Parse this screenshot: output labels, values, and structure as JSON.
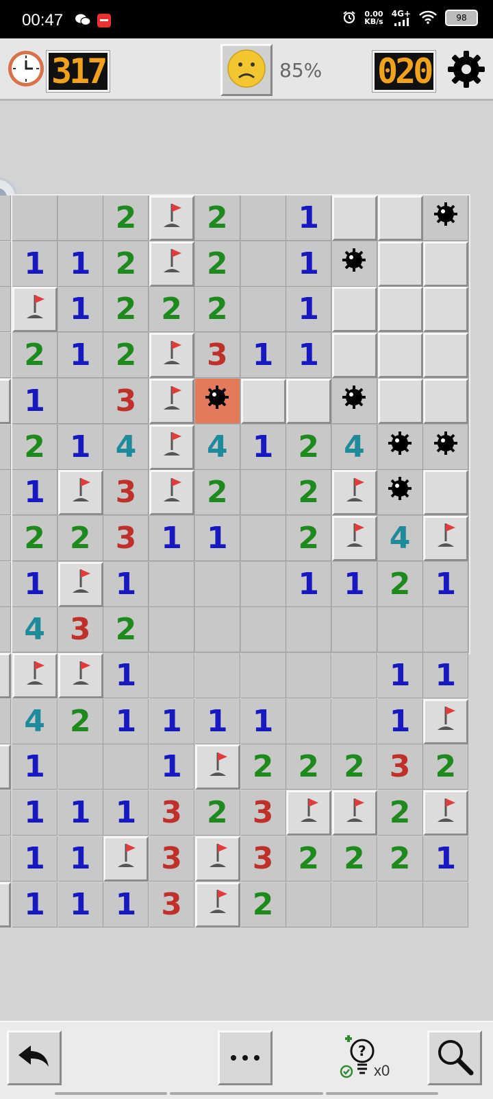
{
  "status_bar": {
    "time": "00:47",
    "net_speed_top": "0.00",
    "net_speed_unit": "KB/s",
    "network": "4G+",
    "battery": "98"
  },
  "header": {
    "timer": "317",
    "progress": "85%",
    "mines_left": "020"
  },
  "bottom": {
    "hint_count": "x0"
  },
  "board": {
    "rows": [
      [
        "",
        "",
        "2",
        "F",
        "2",
        "",
        "1",
        "C",
        "C",
        "M"
      ],
      [
        "1",
        "1",
        "2",
        "F",
        "2",
        "",
        "1",
        "M",
        "C",
        "C"
      ],
      [
        "F",
        "1",
        "2",
        "2",
        "2",
        "",
        "1",
        "C",
        "C",
        "C"
      ],
      [
        "2",
        "1",
        "2",
        "F",
        "3",
        "1",
        "1",
        "C",
        "C",
        "C"
      ],
      [
        "1",
        "",
        "3",
        "F",
        "X",
        "C",
        "C",
        "M",
        "C",
        "C"
      ],
      [
        "2",
        "1",
        "4",
        "F",
        "4",
        "1",
        "2",
        "4",
        "M",
        "M"
      ],
      [
        "1",
        "F",
        "3",
        "F",
        "2",
        "",
        "2",
        "F",
        "M",
        "C"
      ],
      [
        "2",
        "2",
        "3",
        "1",
        "1",
        "",
        "2",
        "F",
        "4",
        "F"
      ],
      [
        "1",
        "F",
        "1",
        "",
        "",
        "",
        "1",
        "1",
        "2",
        "1"
      ],
      [
        "4",
        "3",
        "2",
        "",
        "",
        "",
        "",
        "",
        "",
        ""
      ],
      [
        "F",
        "F",
        "1",
        "",
        "",
        "",
        "",
        "",
        "1",
        "1"
      ],
      [
        "4",
        "2",
        "1",
        "1",
        "1",
        "1",
        "",
        "",
        "1",
        "F"
      ],
      [
        "1",
        "",
        "",
        "1",
        "F",
        "2",
        "2",
        "2",
        "3",
        "2"
      ],
      [
        "1",
        "1",
        "1",
        "3",
        "2",
        "3",
        "F",
        "F",
        "2",
        "F"
      ],
      [
        "1",
        "1",
        "F",
        "3",
        "F",
        "3",
        "2",
        "2",
        "2",
        "1"
      ],
      [
        "1",
        "1",
        "1",
        "3",
        "F",
        "2",
        "",
        "",
        "",
        ""
      ]
    ],
    "left_edge": [
      "open",
      "open",
      "open",
      "open",
      "closed",
      "open",
      "open",
      "open",
      "open",
      "open",
      "closed",
      "open",
      "closed",
      "open",
      "open",
      "closed"
    ]
  },
  "colors": {
    "n1": "#1818c0",
    "n2": "#1e8a1e",
    "n3": "#c0302a",
    "n4": "#1f8a9a",
    "counter": "#f1a21d",
    "exploded": "#e37a5c"
  },
  "icons": [
    "clock-icon",
    "sad-face-icon",
    "gear-icon",
    "undo-icon",
    "more-icon",
    "hint-bulb-icon",
    "magnifier-icon"
  ]
}
